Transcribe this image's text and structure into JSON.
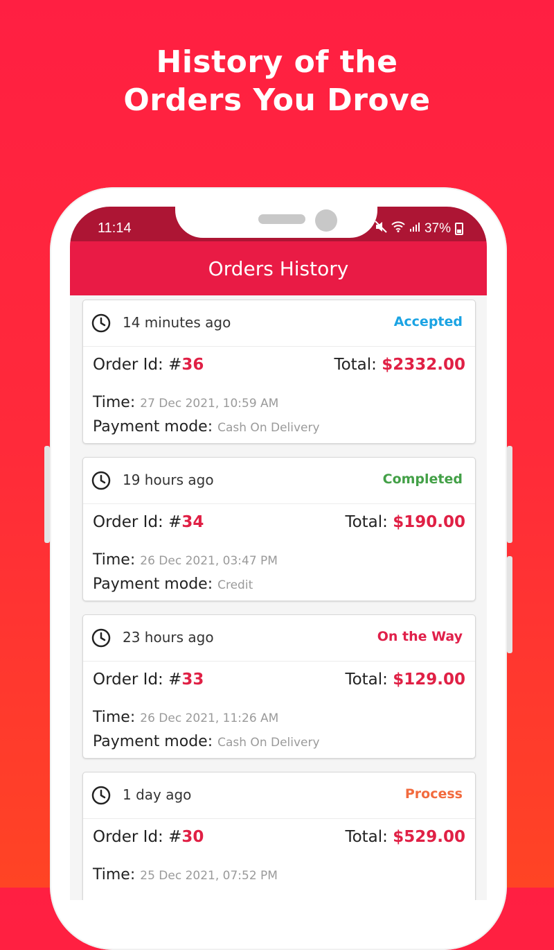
{
  "headline": {
    "line1": "History of the",
    "line2": "Orders You Drove"
  },
  "statusbar": {
    "time": "11:14",
    "battery": "37%"
  },
  "appbar": {
    "title": "Orders History"
  },
  "labels": {
    "order_id": "Order Id: #",
    "total": "Total: ",
    "time": "Time: ",
    "payment": "Payment mode: "
  },
  "orders": [
    {
      "ago": "14 minutes ago",
      "status": "Accepted",
      "status_color": "#1aa3e3",
      "id": "36",
      "total": "$2332.00",
      "time": "27 Dec 2021, 10:59 AM",
      "payment": "Cash On Delivery"
    },
    {
      "ago": "19 hours ago",
      "status": "Completed",
      "status_color": "#43a047",
      "id": "34",
      "total": "$190.00",
      "time": "26 Dec 2021, 03:47 PM",
      "payment": "Credit"
    },
    {
      "ago": "23 hours ago",
      "status": "On the Way",
      "status_color": "#e0204a",
      "id": "33",
      "total": "$129.00",
      "time": "26 Dec 2021, 11:26 AM",
      "payment": "Cash On Delivery"
    },
    {
      "ago": "1 day ago",
      "status": "Process",
      "status_color": "#f26a3d",
      "id": "30",
      "total": "$529.00",
      "time": "25 Dec 2021, 07:52 PM",
      "payment": ""
    }
  ],
  "icons": {
    "clock": "clock-icon",
    "mute": "mute-icon",
    "wifi": "wifi-icon",
    "signal": "signal-icon",
    "battery": "battery-icon"
  }
}
